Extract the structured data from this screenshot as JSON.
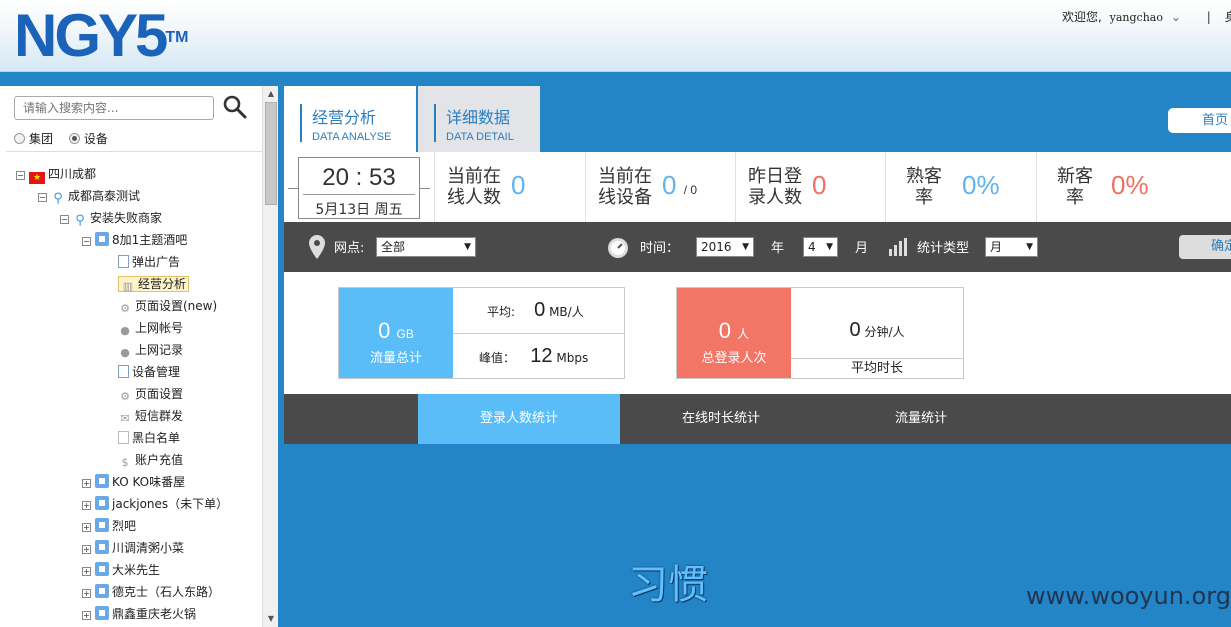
{
  "header": {
    "logo": "NGY5",
    "logo_tm": "TM",
    "welcome": "欢迎您,",
    "username": "yangchao",
    "right_text": "身"
  },
  "sidebar": {
    "search_placeholder": "请输入搜索内容...",
    "radio_group": "集团",
    "radio_device": "设备",
    "tree": {
      "n0": "四川成都",
      "n1": "成都高泰测试",
      "n2": "安装失败商家",
      "n3": "8加1主题酒吧",
      "n4": "弹出广告",
      "n5": "经营分析",
      "n6": "页面设置(new)",
      "n7": "上网帐号",
      "n8": "上网记录",
      "n9": "设备管理",
      "n10": "页面设置",
      "n11": "短信群发",
      "n12": "黑白名单",
      "n13": "账户充值",
      "n14": "KO KO味番屋",
      "n15": "jackjones（未下单）",
      "n16": "烈吧",
      "n17": "川调清粥小菜",
      "n18": "大米先生",
      "n19": "德克士（石人东路）",
      "n20": "鼎鑫重庆老火锅"
    }
  },
  "tabs": {
    "t1_cn": "经营分析",
    "t1_en": "DATA ANALYSE",
    "t2_cn": "详细数据",
    "t2_en": "DATA DETAIL",
    "home": "首页"
  },
  "stats": {
    "time": "20 : 53",
    "date": "5月13日 周五",
    "online_users_l1": "当前在",
    "online_users_l2": "线人数",
    "online_users_val": "0",
    "online_dev_l1": "当前在",
    "online_dev_l2": "线设备",
    "online_dev_val": "0",
    "online_dev_total": "/ 0",
    "yesterday_l1": "昨日登",
    "yesterday_l2": "录人数",
    "yesterday_val": "0",
    "regular_l1": "熟客",
    "regular_l2": "率",
    "regular_val": "0%",
    "new_l1": "新客",
    "new_l2": "率",
    "new_val": "0%"
  },
  "filter": {
    "site_label": "网点:",
    "site_value": "全部",
    "time_label": "时间：",
    "year_value": "2016",
    "year_unit": "年",
    "month_value": "4",
    "month_unit": "月",
    "stat_type_label": "统计类型",
    "stat_type_value": "月",
    "confirm": "确定"
  },
  "traffic": {
    "total_value": "0",
    "total_unit": "GB",
    "total_caption": "流量总计",
    "avg_label": "平均:",
    "avg_value": "0",
    "avg_unit": "MB/人",
    "peak_label": "峰值：",
    "peak_value": "12",
    "peak_unit": "Mbps"
  },
  "logins": {
    "total_value": "0",
    "total_unit": "人",
    "total_caption": "总登录人次",
    "avg_value": "0",
    "avg_unit": "分钟/人",
    "avg_caption": "平均时长"
  },
  "chart_tabs": {
    "tab1": "登录人数统计",
    "tab2": "在线时长统计",
    "tab3": "流量统计"
  },
  "chart_area": {
    "habit": "习惯",
    "watermark": "www.wooyun.org"
  },
  "colors": {
    "brand_blue": "#2385c6",
    "stat_blue": "#5fb3ef",
    "stat_red": "#f07060",
    "active_chart_tab": "#5bbdf8",
    "dark_bar": "#4a4a4a"
  },
  "icons": {
    "search": "search-icon",
    "location": "map-pin-icon",
    "clock": "stopwatch-icon",
    "stat_type": "bar-chart-icon"
  }
}
